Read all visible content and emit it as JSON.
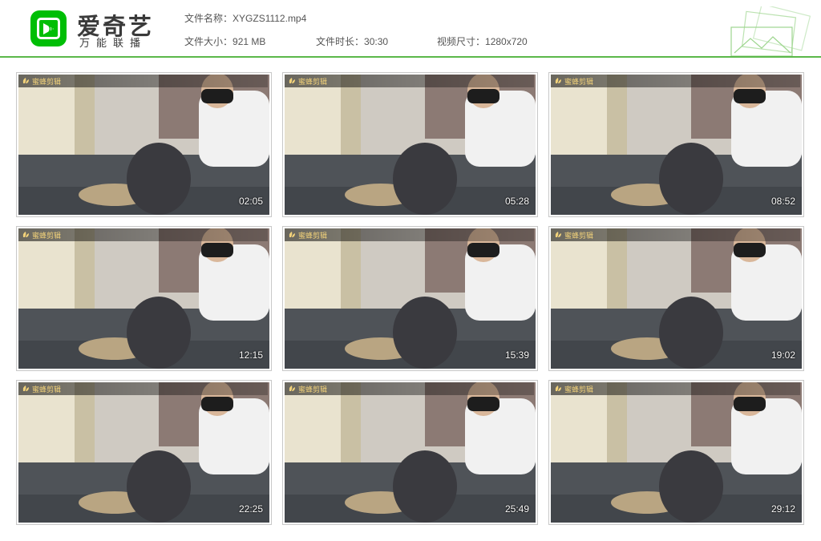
{
  "header": {
    "brand_name": "爱奇艺",
    "brand_slogan": "万能联播",
    "file_name_label": "文件名称：",
    "file_name": "XYGZS1112.mp4",
    "file_size_label": "文件大小：",
    "file_size": "921 MB",
    "duration_label": "文件时长：",
    "duration": "30:30",
    "resolution_label": "视频尺寸：",
    "resolution": "1280x720"
  },
  "colors": {
    "brand_green": "#00be06",
    "divider_green": "#5bb84a",
    "watermark_text": "#f2d27a"
  },
  "watermark": "蜜蜂剪辑",
  "thumbnails": [
    {
      "timestamp": "02:05"
    },
    {
      "timestamp": "05:28"
    },
    {
      "timestamp": "08:52"
    },
    {
      "timestamp": "12:15"
    },
    {
      "timestamp": "15:39"
    },
    {
      "timestamp": "19:02"
    },
    {
      "timestamp": "22:25"
    },
    {
      "timestamp": "25:49"
    },
    {
      "timestamp": "29:12"
    }
  ]
}
